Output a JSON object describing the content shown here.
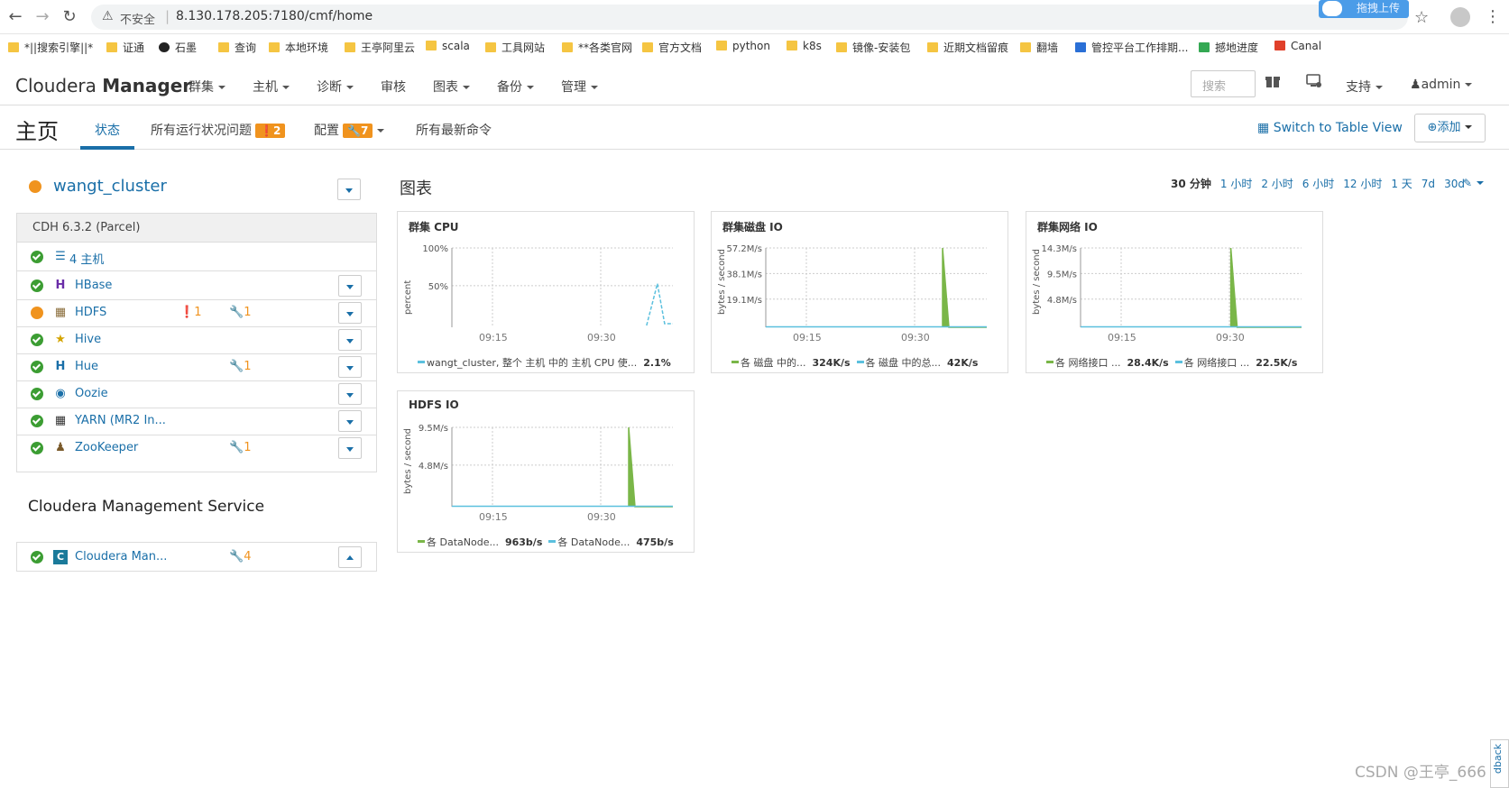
{
  "browser": {
    "insecure_label": "不安全",
    "url": "8.130.178.205:7180/cmf/home",
    "upload_label": "拖拽上传"
  },
  "bookmarks": [
    "*||搜索引擎||*",
    "证通",
    "石墨",
    "查询",
    "本地环境",
    "王亭阿里云",
    "scala",
    "工具网站",
    "**各类官网",
    "官方文档",
    "python",
    "k8s",
    "镜像-安装包",
    "近期文档留痕",
    "翻墙",
    "管控平台工作排期...",
    "撼地进度",
    "Canal"
  ],
  "header": {
    "brand_light": "Cloudera",
    "brand_bold": "Manager",
    "nav": [
      "群集",
      "主机",
      "诊断",
      "审核",
      "图表",
      "备份",
      "管理"
    ],
    "search_placeholder": "搜索",
    "support": "支持",
    "user": "admin"
  },
  "subheader": {
    "title": "主页",
    "tabs": {
      "status": "状态",
      "issues": "所有运行状况问题",
      "issues_count": "2",
      "config": "配置",
      "config_count": "7",
      "commands": "所有最新命令"
    },
    "switch_view": "Switch to Table View",
    "add": "添加"
  },
  "cluster": {
    "name": "wangt_cluster",
    "version": "CDH 6.3.2 (Parcel)",
    "hosts": "4 主机",
    "services": [
      {
        "name": "HBase",
        "status": "good",
        "alerts": "",
        "config": ""
      },
      {
        "name": "HDFS",
        "status": "warn",
        "alerts": "1",
        "config": "1"
      },
      {
        "name": "Hive",
        "status": "good",
        "alerts": "",
        "config": ""
      },
      {
        "name": "Hue",
        "status": "good",
        "alerts": "",
        "config": "1"
      },
      {
        "name": "Oozie",
        "status": "good",
        "alerts": "",
        "config": ""
      },
      {
        "name": "YARN (MR2 In...",
        "status": "good",
        "alerts": "",
        "config": ""
      },
      {
        "name": "ZooKeeper",
        "status": "good",
        "alerts": "",
        "config": "1"
      }
    ]
  },
  "cms": {
    "title": "Cloudera Management Service",
    "service": "Cloudera Man...",
    "config": "4"
  },
  "charts": {
    "title": "图表",
    "ranges": [
      "30 分钟",
      "1 小时",
      "2 小时",
      "6 小时",
      "12 小时",
      "1 天",
      "7d",
      "30d"
    ],
    "selected_range": "30 分钟"
  },
  "chart_data": [
    {
      "type": "area",
      "title": "群集 CPU",
      "ylabel": "percent",
      "yticks": [
        "100%",
        "50%"
      ],
      "xticks": [
        "09:15",
        "09:30"
      ],
      "series": [
        {
          "name": "wangt_cluster, 整个 主机 中的 主机 CPU 使...",
          "value": "2.1%",
          "color": "#5bc0de"
        }
      ]
    },
    {
      "type": "area",
      "title": "群集磁盘 IO",
      "ylabel": "bytes / second",
      "yticks": [
        "57.2M/s",
        "38.1M/s",
        "19.1M/s"
      ],
      "xticks": [
        "09:15",
        "09:30"
      ],
      "series": [
        {
          "name": "各 磁盘 中的...",
          "value": "324K/s",
          "color": "#7ab648"
        },
        {
          "name": "各 磁盘 中的总...",
          "value": "42K/s",
          "color": "#5bc0de"
        }
      ]
    },
    {
      "type": "area",
      "title": "群集网络 IO",
      "ylabel": "bytes / second",
      "yticks": [
        "14.3M/s",
        "9.5M/s",
        "4.8M/s"
      ],
      "xticks": [
        "09:15",
        "09:30"
      ],
      "series": [
        {
          "name": "各 网络接口 ...",
          "value": "28.4K/s",
          "color": "#7ab648"
        },
        {
          "name": "各 网络接口 ...",
          "value": "22.5K/s",
          "color": "#5bc0de"
        }
      ]
    },
    {
      "type": "area",
      "title": "HDFS IO",
      "ylabel": "bytes / second",
      "yticks": [
        "9.5M/s",
        "4.8M/s"
      ],
      "xticks": [
        "09:15",
        "09:30"
      ],
      "series": [
        {
          "name": "各 DataNode...",
          "value": "963b/s",
          "color": "#7ab648"
        },
        {
          "name": "各 DataNode...",
          "value": "475b/s",
          "color": "#5bc0de"
        }
      ]
    }
  ],
  "watermark": "CSDN @王亭_666",
  "feedback": "dback"
}
